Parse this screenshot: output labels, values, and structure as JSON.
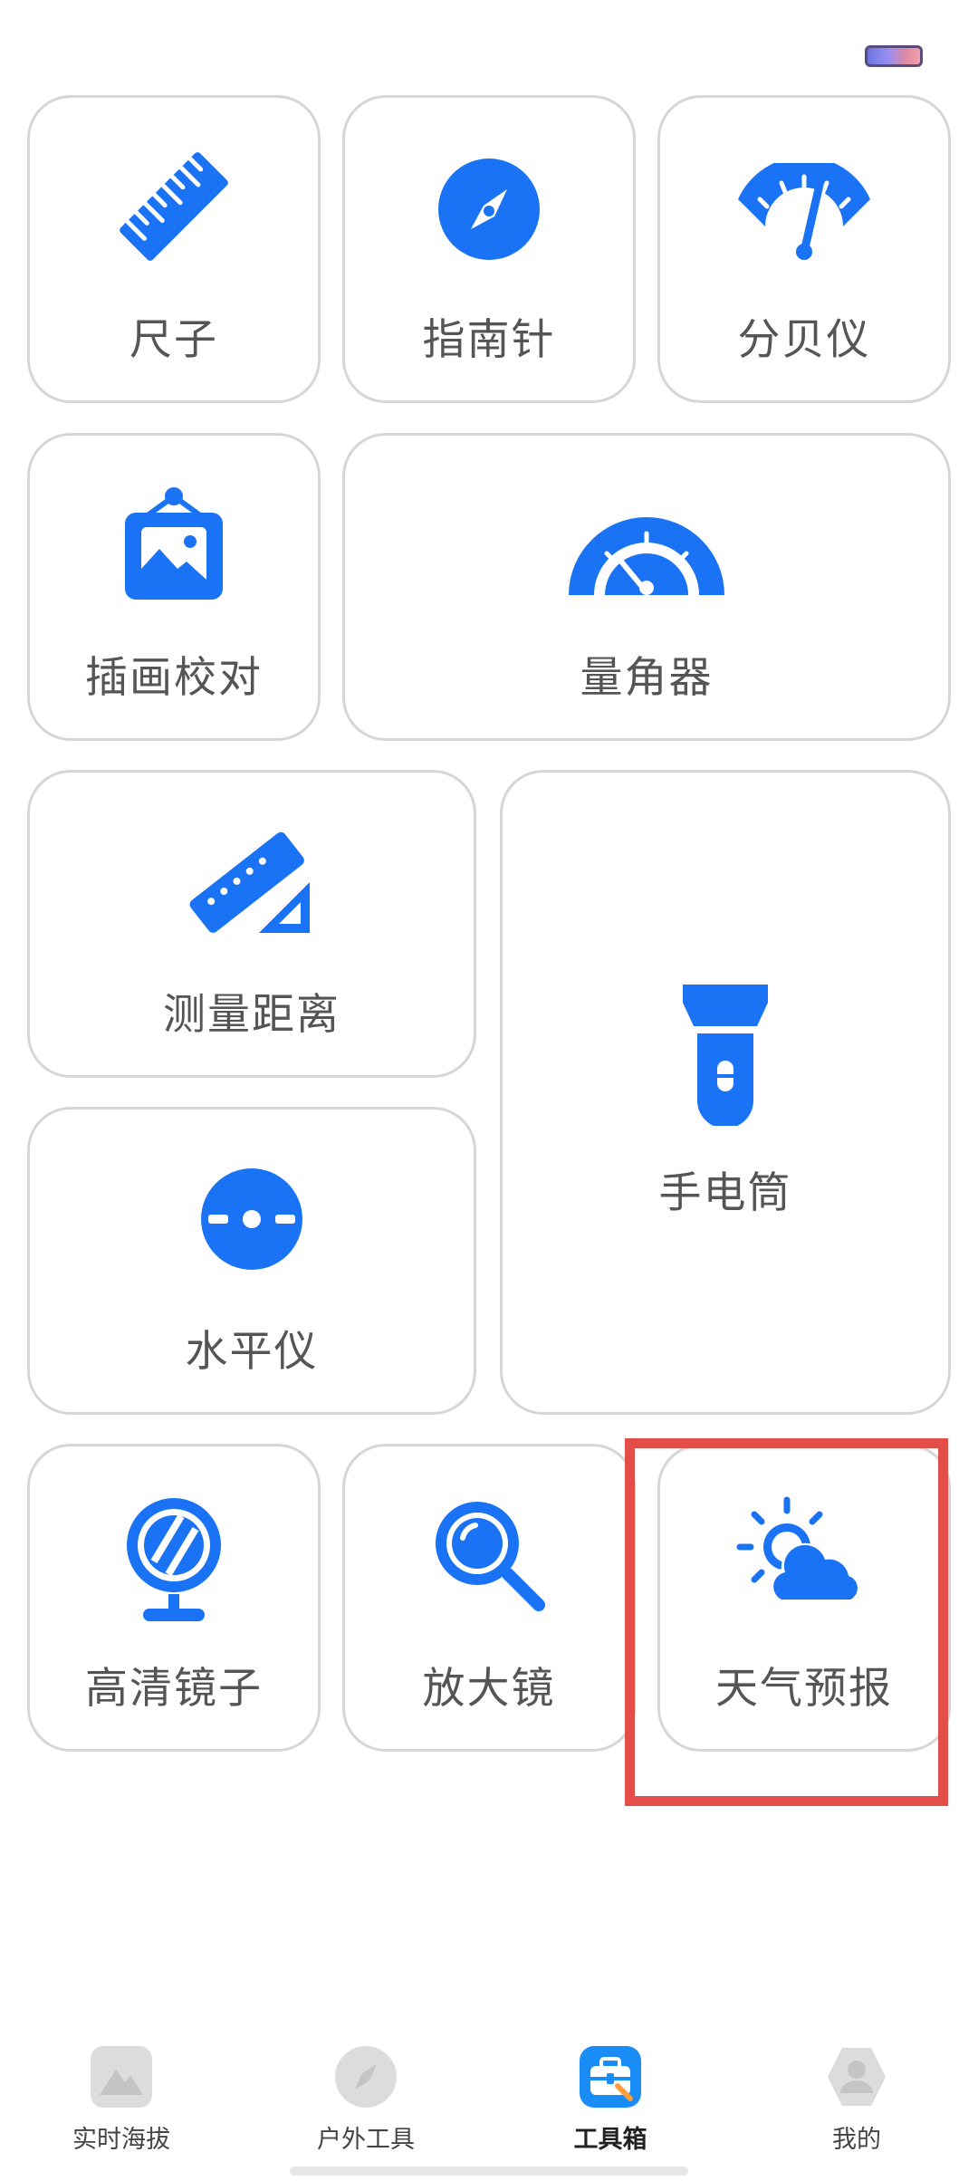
{
  "status_bar": {
    "battery_icon": "battery-icon"
  },
  "tools": [
    {
      "id": "ruler",
      "label": "尺子",
      "icon": "ruler-icon"
    },
    {
      "id": "compass",
      "label": "指南针",
      "icon": "compass-icon"
    },
    {
      "id": "decibel",
      "label": "分贝仪",
      "icon": "gauge-icon"
    },
    {
      "id": "illustration",
      "label": "插画校对",
      "icon": "picture-frame-icon"
    },
    {
      "id": "protractor",
      "label": "量角器",
      "icon": "protractor-icon"
    },
    {
      "id": "measure",
      "label": "测量距离",
      "icon": "set-square-icon"
    },
    {
      "id": "flashlight",
      "label": "手电筒",
      "icon": "flashlight-icon"
    },
    {
      "id": "level",
      "label": "水平仪",
      "icon": "spirit-level-icon"
    },
    {
      "id": "mirror",
      "label": "高清镜子",
      "icon": "mirror-icon"
    },
    {
      "id": "magnifier",
      "label": "放大镜",
      "icon": "magnifier-icon"
    },
    {
      "id": "weather",
      "label": "天气预报",
      "icon": "weather-icon"
    }
  ],
  "tabs": [
    {
      "label": "实时海拔",
      "icon": "mountain-icon",
      "active": false
    },
    {
      "label": "户外工具",
      "icon": "compass-icon",
      "active": false
    },
    {
      "label": "工具箱",
      "icon": "toolbox-icon",
      "active": true
    },
    {
      "label": "我的",
      "icon": "profile-icon",
      "active": false
    }
  ],
  "colors": {
    "accent": "#1a73f5",
    "border": "#d6d6d6",
    "highlight": "#e34e48",
    "label": "#555555"
  }
}
